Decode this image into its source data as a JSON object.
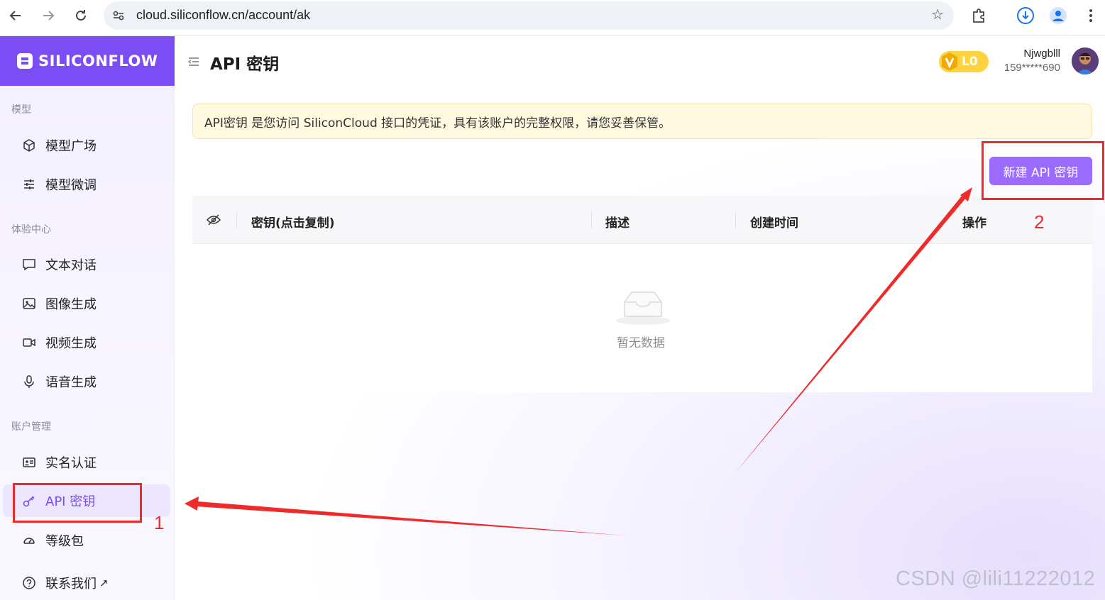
{
  "browser": {
    "url": "cloud.siliconflow.cn/account/ak"
  },
  "sidebar": {
    "logo": "SILICONFLOW",
    "sections": [
      {
        "label": "模型"
      },
      {
        "label": "体验中心"
      },
      {
        "label": "账户管理"
      }
    ],
    "items": [
      {
        "label": "模型广场",
        "icon": "cube-icon"
      },
      {
        "label": "模型微调",
        "icon": "sliders-icon"
      },
      {
        "label": "文本对话",
        "icon": "chat-icon"
      },
      {
        "label": "图像生成",
        "icon": "image-icon"
      },
      {
        "label": "视频生成",
        "icon": "video-icon"
      },
      {
        "label": "语音生成",
        "icon": "microphone-icon"
      },
      {
        "label": "实名认证",
        "icon": "id-card-icon"
      },
      {
        "label": "API 密钥",
        "icon": "key-icon",
        "active": true
      },
      {
        "label": "等级包",
        "icon": "gauge-icon"
      },
      {
        "label": "联系我们",
        "icon": "help-icon"
      }
    ]
  },
  "header": {
    "title": "API 密钥",
    "level": "L0",
    "username": "Njwgblll",
    "phone": "159*****690"
  },
  "notice": "API密钥 是您访问 SiliconCloud 接口的凭证，具有该账户的完整权限，请您妥善保管。",
  "create_button": "新建 API 密钥",
  "table": {
    "columns": [
      "密钥(点击复制)",
      "描述",
      "创建时间",
      "操作"
    ],
    "empty_text": "暂无数据"
  },
  "annotations": {
    "num1": "1",
    "num2": "2"
  },
  "watermark": "CSDN @lili11222012",
  "colors": {
    "brand": "#7c4df5",
    "button": "#9b6bff",
    "annotation": "#ef2a2a"
  }
}
